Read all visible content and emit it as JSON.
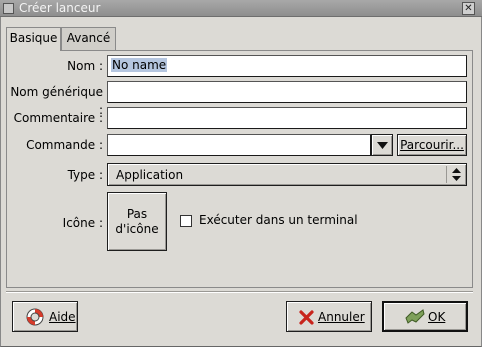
{
  "window": {
    "title": "Créer lanceur"
  },
  "tabs": [
    {
      "label": "Basique",
      "active": true
    },
    {
      "label": "Avancé",
      "active": false
    }
  ],
  "form": {
    "name_label": "Nom :",
    "name_value": "No name",
    "generic_label": "Nom générique :",
    "generic_value": "",
    "comment_label": "Commentaire :",
    "comment_value": "",
    "command_label": "Commande :",
    "command_value": "",
    "browse_label": "Parcourir...",
    "type_label": "Type :",
    "type_value": "Application",
    "icon_label": "Icône :",
    "icon_button_line1": "Pas",
    "icon_button_line2": "d'icône",
    "terminal_label": "Exécuter dans un terminal",
    "terminal_checked": false
  },
  "buttons": {
    "help": "Aide",
    "cancel": "Annuler",
    "ok": "OK"
  },
  "icons": {
    "help": "lifebuoy-icon",
    "cancel": "red-x-icon",
    "ok": "check-hand-icon",
    "combo": "chevron-down-icon",
    "spin": "up-down-arrows-icon"
  }
}
